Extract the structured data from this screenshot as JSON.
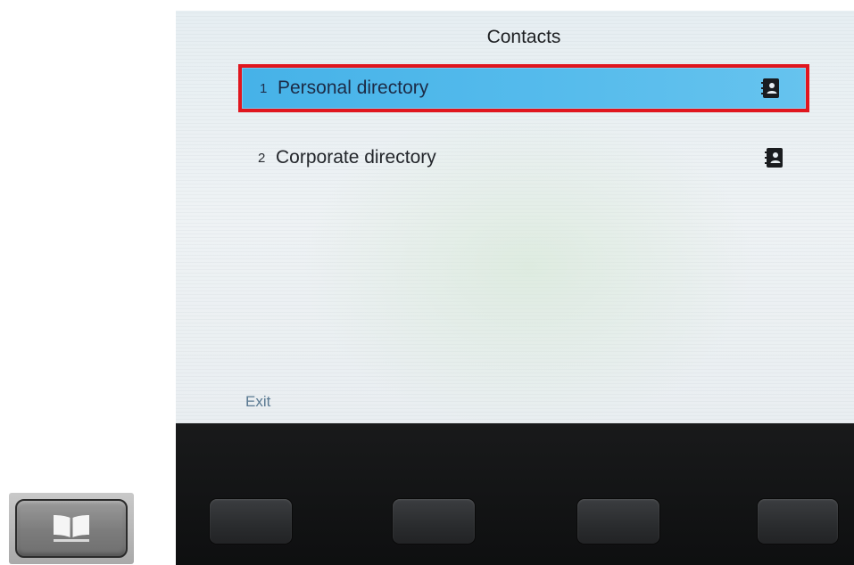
{
  "screen": {
    "title": "Contacts",
    "menu": [
      {
        "number": "1",
        "label": "Personal directory",
        "icon": "contact-book-icon",
        "selected": true
      },
      {
        "number": "2",
        "label": "Corporate directory",
        "icon": "contact-book-icon",
        "selected": false
      }
    ],
    "softkeys": {
      "left_label": "Exit"
    }
  },
  "hardware": {
    "contacts_button_icon": "open-book-icon"
  },
  "colors": {
    "selection": "#4fb6ea",
    "highlight_border": "#e0161e",
    "text": "#1d1f22"
  }
}
